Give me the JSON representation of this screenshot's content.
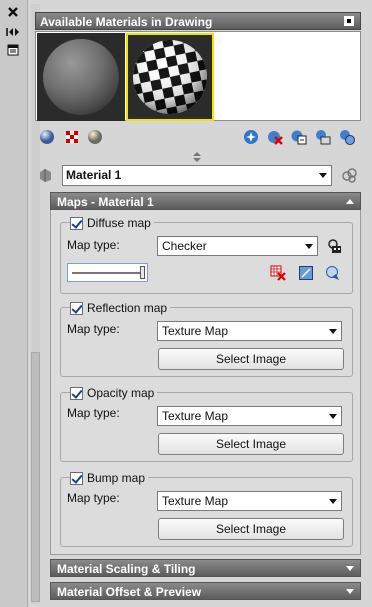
{
  "dock": {
    "icons": [
      "close-icon",
      "collapse-arrows-icon",
      "properties-icon"
    ]
  },
  "gallery": {
    "title": "Available Materials in Drawing",
    "swatches": [
      {
        "pattern": "plain-gray",
        "selected": false
      },
      {
        "pattern": "checker",
        "selected": true
      }
    ],
    "selected_border_color": "#f2e400",
    "toolbar_left": [
      "sphere-icon",
      "checker-icon",
      "background-sphere-icon"
    ],
    "toolbar_right": [
      "create-material-icon",
      "purge-icon",
      "apply-icon",
      "select-objects-icon",
      "attach-icon"
    ]
  },
  "material": {
    "selected": "Material 1"
  },
  "maps": {
    "title": "Maps - Material 1",
    "groups": [
      {
        "title": "Diffuse map",
        "checked": true,
        "type_label": "Map type:",
        "type_value": "Checker",
        "slider_level": 1.0,
        "icons": [
          "delete-map-icon",
          "edit-map-icon",
          "synchronize-icon"
        ]
      },
      {
        "title": "Reflection map",
        "checked": true,
        "type_label": "Map type:",
        "type_value": "Texture Map",
        "button": "Select Image"
      },
      {
        "title": "Opacity map",
        "checked": true,
        "type_label": "Map type:",
        "type_value": "Texture Map",
        "button": "Select Image"
      },
      {
        "title": "Bump map",
        "checked": true,
        "type_label": "Map type:",
        "type_value": "Texture Map",
        "button": "Select Image"
      }
    ]
  },
  "sections": {
    "scaling": "Material Scaling & Tiling",
    "offset": "Material Offset & Preview"
  },
  "colors": {
    "header_gradient_top": "#8a8a8a",
    "header_gradient_bottom": "#5c5c5c",
    "panel_bg": "#dcdcdc"
  }
}
